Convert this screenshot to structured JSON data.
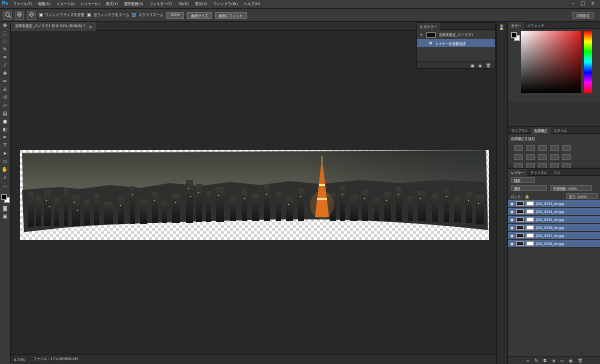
{
  "app": {
    "logo": "Ps"
  },
  "menu": [
    "ファイル(F)",
    "編集(E)",
    "イメージ(I)",
    "レイヤー(L)",
    "書式(Y)",
    "選択範囲(S)",
    "フィルター(T)",
    "3D(D)",
    "表示(V)",
    "ウィンドウ(W)",
    "ヘルプ(H)"
  ],
  "options": {
    "checks": [
      "ウィンドウサイズを変更",
      "全ウィンドウをズーム",
      "スクラブズーム"
    ],
    "buttons": [
      "100%",
      "画面サイズ",
      "画面にフィット"
    ],
    "workspace": "初期設定"
  },
  "doc": {
    "tab_title": "名称未設定_パノラマ1 @ 8.33% (RGB/8) *",
    "close": "×"
  },
  "status": {
    "zoom": "8.33%",
    "info": "ファイル : 171.0M/608.4M"
  },
  "history": {
    "tabs": [
      "ヒストリー"
    ],
    "snapshot": "名称未設定_パノラマ1",
    "steps": [
      "レイヤーを自動合成"
    ]
  },
  "color": {
    "tabs": [
      "カラー",
      "スウォッチ"
    ]
  },
  "adjust": {
    "tabs": [
      "ライブラリ",
      "色調補正",
      "スタイル"
    ],
    "title": "色調補正を追加"
  },
  "layers": {
    "tabs": [
      "レイヤー",
      "チャンネル",
      "パス"
    ],
    "kind": "種類",
    "blend": "通常",
    "opacity": "不透明度: 100%",
    "lock": "ロック:",
    "fill": "塗り: 100%",
    "items": [
      "DSC_9033_ne.jpg",
      "DSC_9034_ne.jpg",
      "DSC_9035_ne.jpg",
      "DSC_9036_ne.jpg",
      "DSC_9037_ne.jpg",
      "DSC_9038_ne.jpg"
    ]
  }
}
